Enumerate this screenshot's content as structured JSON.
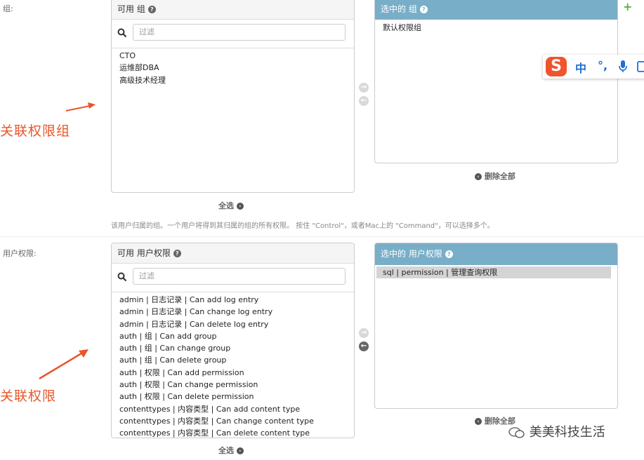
{
  "groups": {
    "label": "组:",
    "available_title": "可用 组",
    "filter_placeholder": "过滤",
    "available_items": [
      "CTO",
      "运维部DBA",
      "高级技术经理"
    ],
    "chosen_title": "选中的 组",
    "chosen_items": [
      "默认权限组"
    ],
    "remove_all": "删除全部",
    "choose_all": "全选",
    "help": "该用户归属的组。一个用户将得到其归属的组的所有权限。 按住 \"Control\"，或者Mac上的 \"Command\"，可以选择多个。",
    "annotation": "关联权限组"
  },
  "permissions": {
    "label": "用户权限:",
    "available_title": "可用 用户权限",
    "filter_placeholder": "过滤",
    "available_items": [
      "admin | 日志记录 | Can add log entry",
      "admin | 日志记录 | Can change log entry",
      "admin | 日志记录 | Can delete log entry",
      "auth | 组 | Can add group",
      "auth | 组 | Can change group",
      "auth | 组 | Can delete group",
      "auth | 权限 | Can add permission",
      "auth | 权限 | Can change permission",
      "auth | 权限 | Can delete permission",
      "contenttypes | 内容类型 | Can add content type",
      "contenttypes | 内容类型 | Can change content type",
      "contenttypes | 内容类型 | Can delete content type"
    ],
    "chosen_title": "选中的 用户权限",
    "chosen_items": [
      "sql | permission | 管理查询权限"
    ],
    "remove_all": "删除全部",
    "choose_all": "全选",
    "annotation": "关联权限"
  },
  "ime": {
    "lang": "中",
    "punct": "°,"
  },
  "watermark": "美美科技生活",
  "colors": {
    "chosen_header": "#79aec8",
    "annotation": "#e8562a"
  }
}
